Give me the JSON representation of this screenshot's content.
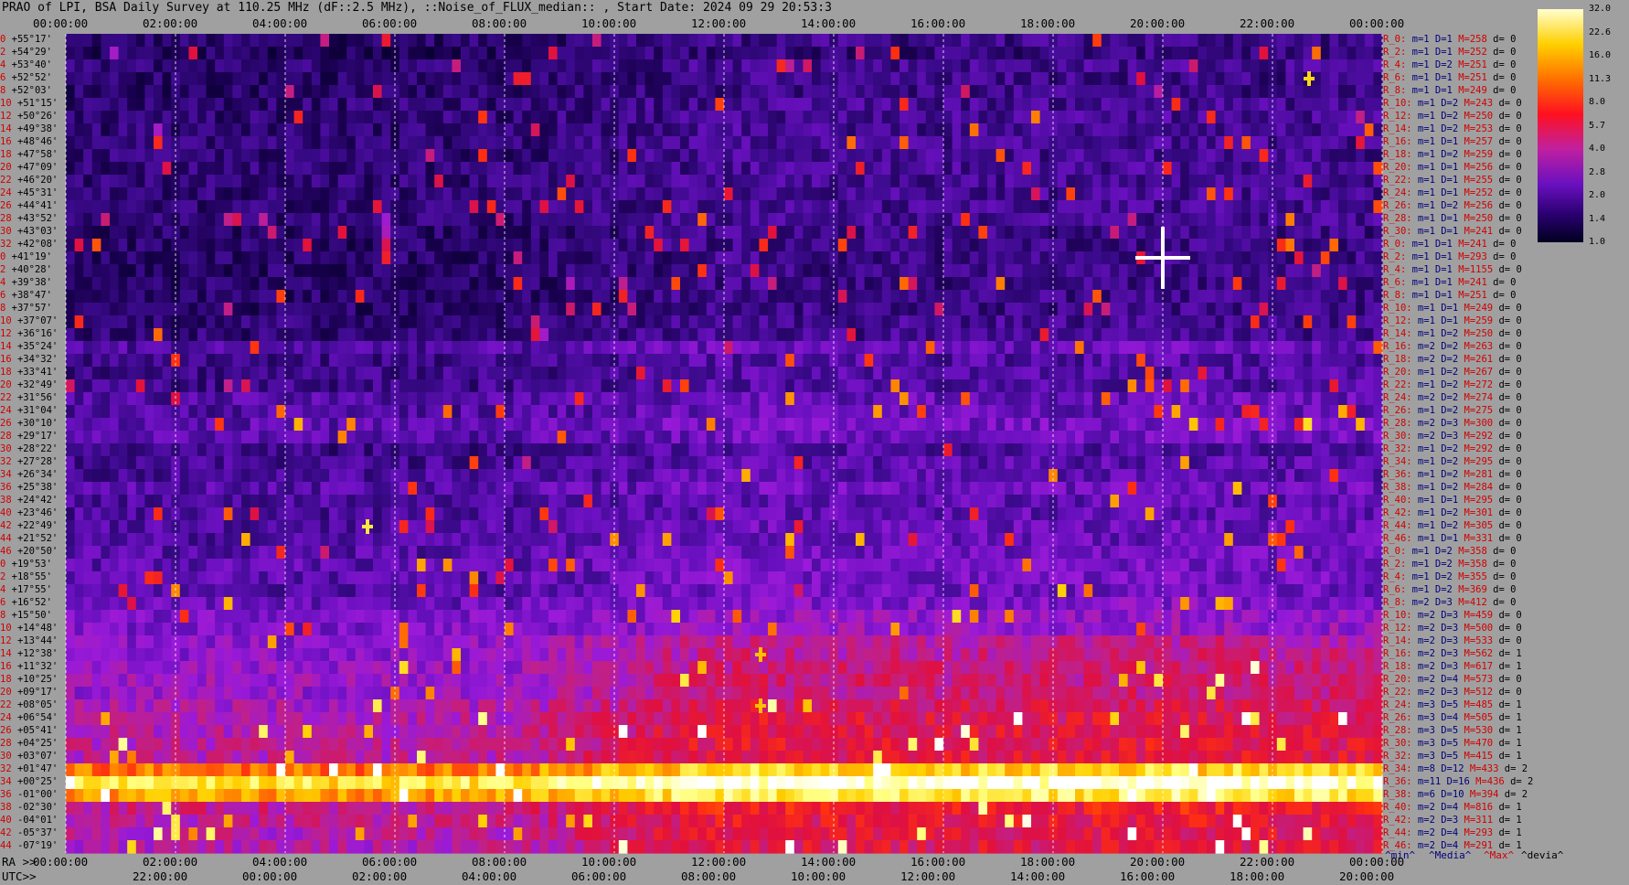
{
  "window": {
    "title": "PRAO of LPI, BSA Daily Survey at 110.25 MHz (dF::2.5 MHz), ::Noise_of_FLUX_median:: , Start Date: 2024 09 29 20:53:3"
  },
  "chart_data": {
    "type": "heatmap",
    "title": "PRAO of LPI, BSA Daily Survey at 110.25 MHz (dF::2.5 MHz), ::Noise_of_FLUX_median:: , Start Date: 2024 09 29 20:53:3",
    "top_time_labels": [
      "00:00:00",
      "02:00:00",
      "04:00:00",
      "06:00:00",
      "08:00:00",
      "10:00:00",
      "12:00:00",
      "14:00:00",
      "16:00:00",
      "18:00:00",
      "20:00:00",
      "22:00:00",
      "00:00:00"
    ],
    "ra_axis": {
      "prefix": "RA >>",
      "labels": [
        "00:00:00",
        "02:00:00",
        "04:00:00",
        "06:00:00",
        "08:00:00",
        "10:00:00",
        "12:00:00",
        "14:00:00",
        "16:00:00",
        "18:00:00",
        "20:00:00",
        "22:00:00",
        "00:00:00"
      ]
    },
    "utc_axis": {
      "prefix": "UTC>>",
      "labels": [
        "22:00:00",
        "00:00:00",
        "02:00:00",
        "04:00:00",
        "06:00:00",
        "08:00:00",
        "10:00:00",
        "12:00:00",
        "14:00:00",
        "16:00:00",
        "18:00:00",
        "20:00:00"
      ]
    },
    "colorbar": {
      "ticks": [
        "32.0",
        "22.6",
        "16.0",
        "11.3",
        "8.0",
        "5.7",
        "4.0",
        "2.8",
        "2.0",
        "1.4",
        "1.0"
      ],
      "range": [
        1.0,
        32.0
      ]
    },
    "rows": [
      {
        "idx": "0",
        "dec": "+55°17'"
      },
      {
        "idx": "2",
        "dec": "+54°29'"
      },
      {
        "idx": "4",
        "dec": "+53°40'"
      },
      {
        "idx": "6",
        "dec": "+52°52'"
      },
      {
        "idx": "8",
        "dec": "+52°03'"
      },
      {
        "idx": "10",
        "dec": "+51°15'"
      },
      {
        "idx": "12",
        "dec": "+50°26'"
      },
      {
        "idx": "14",
        "dec": "+49°38'"
      },
      {
        "idx": "16",
        "dec": "+48°46'"
      },
      {
        "idx": "18",
        "dec": "+47°58'"
      },
      {
        "idx": "20",
        "dec": "+47°09'"
      },
      {
        "idx": "22",
        "dec": "+46°20'"
      },
      {
        "idx": "24",
        "dec": "+45°31'"
      },
      {
        "idx": "26",
        "dec": "+44°41'"
      },
      {
        "idx": "28",
        "dec": "+43°52'"
      },
      {
        "idx": "30",
        "dec": "+43°03'"
      },
      {
        "idx": "32",
        "dec": "+42°08'"
      },
      {
        "idx": "0",
        "dec": "+41°19'"
      },
      {
        "idx": "2",
        "dec": "+40°28'"
      },
      {
        "idx": "4",
        "dec": "+39°38'"
      },
      {
        "idx": "6",
        "dec": "+38°47'"
      },
      {
        "idx": "8",
        "dec": "+37°57'"
      },
      {
        "idx": "10",
        "dec": "+37°07'"
      },
      {
        "idx": "12",
        "dec": "+36°16'"
      },
      {
        "idx": "14",
        "dec": "+35°24'"
      },
      {
        "idx": "16",
        "dec": "+34°32'"
      },
      {
        "idx": "18",
        "dec": "+33°41'"
      },
      {
        "idx": "20",
        "dec": "+32°49'"
      },
      {
        "idx": "22",
        "dec": "+31°56'"
      },
      {
        "idx": "24",
        "dec": "+31°04'"
      },
      {
        "idx": "26",
        "dec": "+30°10'"
      },
      {
        "idx": "28",
        "dec": "+29°17'"
      },
      {
        "idx": "30",
        "dec": "+28°22'"
      },
      {
        "idx": "32",
        "dec": "+27°28'"
      },
      {
        "idx": "34",
        "dec": "+26°34'"
      },
      {
        "idx": "36",
        "dec": "+25°38'"
      },
      {
        "idx": "38",
        "dec": "+24°42'"
      },
      {
        "idx": "40",
        "dec": "+23°46'"
      },
      {
        "idx": "42",
        "dec": "+22°49'"
      },
      {
        "idx": "44",
        "dec": "+21°52'"
      },
      {
        "idx": "46",
        "dec": "+20°50'"
      },
      {
        "idx": "0",
        "dec": "+19°53'"
      },
      {
        "idx": "2",
        "dec": "+18°55'"
      },
      {
        "idx": "4",
        "dec": "+17°55'"
      },
      {
        "idx": "6",
        "dec": "+16°52'"
      },
      {
        "idx": "8",
        "dec": "+15°50'"
      },
      {
        "idx": "10",
        "dec": "+14°48'"
      },
      {
        "idx": "12",
        "dec": "+13°44'"
      },
      {
        "idx": "14",
        "dec": "+12°38'"
      },
      {
        "idx": "16",
        "dec": "+11°32'"
      },
      {
        "idx": "18",
        "dec": "+10°25'"
      },
      {
        "idx": "20",
        "dec": "+09°17'"
      },
      {
        "idx": "22",
        "dec": "+08°05'"
      },
      {
        "idx": "24",
        "dec": "+06°54'"
      },
      {
        "idx": "26",
        "dec": "+05°41'"
      },
      {
        "idx": "28",
        "dec": "+04°25'"
      },
      {
        "idx": "30",
        "dec": "+03°07'"
      },
      {
        "idx": "32",
        "dec": "+01°47'"
      },
      {
        "idx": "34",
        "dec": "+00°25'"
      },
      {
        "idx": "36",
        "dec": "-01°00'"
      },
      {
        "idx": "38",
        "dec": "-02°30'"
      },
      {
        "idx": "40",
        "dec": "-04°01'"
      },
      {
        "idx": "42",
        "dec": "-05°37'"
      },
      {
        "idx": "44",
        "dec": "-07°19'"
      }
    ],
    "stats": [
      {
        "r": "R_0:",
        "m": "m=1",
        "d": "D=1",
        "M": "M=258",
        "dv": "d= 0"
      },
      {
        "r": "R_2:",
        "m": "m=1",
        "d": "D=1",
        "M": "M=252",
        "dv": "d= 0"
      },
      {
        "r": "R_4:",
        "m": "m=1",
        "d": "D=2",
        "M": "M=251",
        "dv": "d= 0"
      },
      {
        "r": "R_6:",
        "m": "m=1",
        "d": "D=1",
        "M": "M=251",
        "dv": "d= 0"
      },
      {
        "r": "R_8:",
        "m": "m=1",
        "d": "D=1",
        "M": "M=249",
        "dv": "d= 0"
      },
      {
        "r": "R_10:",
        "m": "m=1",
        "d": "D=2",
        "M": "M=243",
        "dv": "d= 0"
      },
      {
        "r": "R_12:",
        "m": "m=1",
        "d": "D=2",
        "M": "M=250",
        "dv": "d= 0"
      },
      {
        "r": "R_14:",
        "m": "m=1",
        "d": "D=2",
        "M": "M=253",
        "dv": "d= 0"
      },
      {
        "r": "R_16:",
        "m": "m=1",
        "d": "D=1",
        "M": "M=257",
        "dv": "d= 0"
      },
      {
        "r": "R_18:",
        "m": "m=1",
        "d": "D=2",
        "M": "M=259",
        "dv": "d= 0"
      },
      {
        "r": "R_20:",
        "m": "m=1",
        "d": "D=1",
        "M": "M=256",
        "dv": "d= 0"
      },
      {
        "r": "R_22:",
        "m": "m=1",
        "d": "D=1",
        "M": "M=255",
        "dv": "d= 0"
      },
      {
        "r": "R_24:",
        "m": "m=1",
        "d": "D=1",
        "M": "M=252",
        "dv": "d= 0"
      },
      {
        "r": "R_26:",
        "m": "m=1",
        "d": "D=2",
        "M": "M=256",
        "dv": "d= 0"
      },
      {
        "r": "R_28:",
        "m": "m=1",
        "d": "D=1",
        "M": "M=250",
        "dv": "d= 0"
      },
      {
        "r": "R_30:",
        "m": "m=1",
        "d": "D=1",
        "M": "M=241",
        "dv": "d= 0"
      },
      {
        "r": "R_0:",
        "m": "m=1",
        "d": "D=1",
        "M": "M=241",
        "dv": "d= 0"
      },
      {
        "r": "R_2:",
        "m": "m=1",
        "d": "D=1",
        "M": "M=293",
        "dv": "d= 0"
      },
      {
        "r": "R_4:",
        "m": "m=1",
        "d": "D=1",
        "M": "M=1155",
        "dv": "d= 0"
      },
      {
        "r": "R_6:",
        "m": "m=1",
        "d": "D=1",
        "M": "M=241",
        "dv": "d= 0"
      },
      {
        "r": "R_8:",
        "m": "m=1",
        "d": "D=1",
        "M": "M=251",
        "dv": "d= 0"
      },
      {
        "r": "R_10:",
        "m": "m=1",
        "d": "D=1",
        "M": "M=249",
        "dv": "d= 0"
      },
      {
        "r": "R_12:",
        "m": "m=1",
        "d": "D=1",
        "M": "M=259",
        "dv": "d= 0"
      },
      {
        "r": "R_14:",
        "m": "m=1",
        "d": "D=2",
        "M": "M=250",
        "dv": "d= 0"
      },
      {
        "r": "R_16:",
        "m": "m=2",
        "d": "D=2",
        "M": "M=263",
        "dv": "d= 0"
      },
      {
        "r": "R_18:",
        "m": "m=2",
        "d": "D=2",
        "M": "M=261",
        "dv": "d= 0"
      },
      {
        "r": "R_20:",
        "m": "m=1",
        "d": "D=2",
        "M": "M=267",
        "dv": "d= 0"
      },
      {
        "r": "R_22:",
        "m": "m=1",
        "d": "D=2",
        "M": "M=272",
        "dv": "d= 0"
      },
      {
        "r": "R_24:",
        "m": "m=2",
        "d": "D=2",
        "M": "M=274",
        "dv": "d= 0"
      },
      {
        "r": "R_26:",
        "m": "m=1",
        "d": "D=2",
        "M": "M=275",
        "dv": "d= 0"
      },
      {
        "r": "R_28:",
        "m": "m=2",
        "d": "D=3",
        "M": "M=300",
        "dv": "d= 0"
      },
      {
        "r": "R_30:",
        "m": "m=2",
        "d": "D=3",
        "M": "M=292",
        "dv": "d= 0"
      },
      {
        "r": "R_32:",
        "m": "m=1",
        "d": "D=2",
        "M": "M=292",
        "dv": "d= 0"
      },
      {
        "r": "R_34:",
        "m": "m=1",
        "d": "D=2",
        "M": "M=295",
        "dv": "d= 0"
      },
      {
        "r": "R_36:",
        "m": "m=1",
        "d": "D=2",
        "M": "M=281",
        "dv": "d= 0"
      },
      {
        "r": "R_38:",
        "m": "m=1",
        "d": "D=2",
        "M": "M=284",
        "dv": "d= 0"
      },
      {
        "r": "R_40:",
        "m": "m=1",
        "d": "D=1",
        "M": "M=295",
        "dv": "d= 0"
      },
      {
        "r": "R_42:",
        "m": "m=1",
        "d": "D=2",
        "M": "M=301",
        "dv": "d= 0"
      },
      {
        "r": "R_44:",
        "m": "m=1",
        "d": "D=2",
        "M": "M=305",
        "dv": "d= 0"
      },
      {
        "r": "R_46:",
        "m": "m=1",
        "d": "D=1",
        "M": "M=331",
        "dv": "d= 0"
      },
      {
        "r": "R_0:",
        "m": "m=1",
        "d": "D=2",
        "M": "M=358",
        "dv": "d= 0"
      },
      {
        "r": "R_2:",
        "m": "m=1",
        "d": "D=2",
        "M": "M=358",
        "dv": "d= 0"
      },
      {
        "r": "R_4:",
        "m": "m=1",
        "d": "D=2",
        "M": "M=355",
        "dv": "d= 0"
      },
      {
        "r": "R_6:",
        "m": "m=1",
        "d": "D=2",
        "M": "M=369",
        "dv": "d= 0"
      },
      {
        "r": "R_8:",
        "m": "m=2",
        "d": "D=3",
        "M": "M=412",
        "dv": "d= 0"
      },
      {
        "r": "R_10:",
        "m": "m=2",
        "d": "D=3",
        "M": "M=459",
        "dv": "d= 0"
      },
      {
        "r": "R_12:",
        "m": "m=2",
        "d": "D=3",
        "M": "M=500",
        "dv": "d= 0"
      },
      {
        "r": "R_14:",
        "m": "m=2",
        "d": "D=3",
        "M": "M=533",
        "dv": "d= 0"
      },
      {
        "r": "R_16:",
        "m": "m=2",
        "d": "D=3",
        "M": "M=562",
        "dv": "d= 1"
      },
      {
        "r": "R_18:",
        "m": "m=2",
        "d": "D=3",
        "M": "M=617",
        "dv": "d= 1"
      },
      {
        "r": "R_20:",
        "m": "m=2",
        "d": "D=4",
        "M": "M=573",
        "dv": "d= 0"
      },
      {
        "r": "R_22:",
        "m": "m=2",
        "d": "D=3",
        "M": "M=512",
        "dv": "d= 0"
      },
      {
        "r": "R_24:",
        "m": "m=3",
        "d": "D=5",
        "M": "M=485",
        "dv": "d= 1"
      },
      {
        "r": "R_26:",
        "m": "m=3",
        "d": "D=4",
        "M": "M=505",
        "dv": "d= 1"
      },
      {
        "r": "R_28:",
        "m": "m=3",
        "d": "D=5",
        "M": "M=530",
        "dv": "d= 1"
      },
      {
        "r": "R_30:",
        "m": "m=3",
        "d": "D=5",
        "M": "M=470",
        "dv": "d= 1"
      },
      {
        "r": "R_32:",
        "m": "m=3",
        "d": "D=5",
        "M": "M=415",
        "dv": "d= 1"
      },
      {
        "r": "R_34:",
        "m": "m=8",
        "d": "D=12",
        "M": "M=433",
        "dv": "d= 2"
      },
      {
        "r": "R_36:",
        "m": "m=11",
        "d": "D=16",
        "M": "M=436",
        "dv": "d= 2"
      },
      {
        "r": "R_38:",
        "m": "m=6",
        "d": "D=10",
        "M": "M=394",
        "dv": "d= 2"
      },
      {
        "r": "R_40:",
        "m": "m=2",
        "d": "D=4",
        "M": "M=816",
        "dv": "d= 1"
      },
      {
        "r": "R_42:",
        "m": "m=2",
        "d": "D=3",
        "M": "M=311",
        "dv": "d= 1"
      },
      {
        "r": "R_44:",
        "m": "m=2",
        "d": "D=4",
        "M": "M=293",
        "dv": "d= 1"
      },
      {
        "r": "R_46:",
        "m": "m=2",
        "d": "D=4",
        "M": "M=291",
        "dv": "d= 1"
      }
    ],
    "legend": {
      "min": "^min^",
      "median": "^Media^",
      "max": "^Max^",
      "dev": "^devia^"
    },
    "palette": [
      "#000020",
      "#1a0050",
      "#3a0a8a",
      "#6a10c0",
      "#9a1ad8",
      "#c0208a",
      "#e01040",
      "#ff3010",
      "#ff8000",
      "#ffd000",
      "#ffff80",
      "#ffffff"
    ],
    "row_levels": [
      1.6,
      1.5,
      1.7,
      1.6,
      1.6,
      1.7,
      1.7,
      1.7,
      1.7,
      1.7,
      1.7,
      1.7,
      1.7,
      1.7,
      1.7,
      1.6,
      1.6,
      1.6,
      1.6,
      1.6,
      1.6,
      1.6,
      1.7,
      1.7,
      2.2,
      1.9,
      1.9,
      1.9,
      2.2,
      2.2,
      2.4,
      2.3,
      1.9,
      2.0,
      2.1,
      2.3,
      2.1,
      2.1,
      2.2,
      2.2,
      2.3,
      2.4,
      2.4,
      2.3,
      2.6,
      2.9,
      3.0,
      3.2,
      3.3,
      3.5,
      3.6,
      3.5,
      4.0,
      4.3,
      4.4,
      4.5,
      4.5,
      12,
      20,
      14,
      5.0,
      4.6,
      4.4,
      4.3
    ],
    "day_factor": [
      1.0,
      1.0,
      1.0,
      1.0,
      1.05,
      1.3,
      1.6,
      1.5,
      1.5,
      1.5,
      1.6,
      1.5,
      1.5
    ],
    "bright_spots": [
      {
        "ra": "20:00",
        "dec": "+41°19'",
        "level": 32
      },
      {
        "ra": "05:30",
        "dec": "+22°49'",
        "level": 20
      },
      {
        "ra": "12:40",
        "dec": "+12°38'",
        "level": 16
      },
      {
        "ra": "12:40",
        "dec": "+08°05'",
        "level": 16
      },
      {
        "ra": "22:40",
        "dec": "+52°52'",
        "level": 18
      }
    ]
  }
}
